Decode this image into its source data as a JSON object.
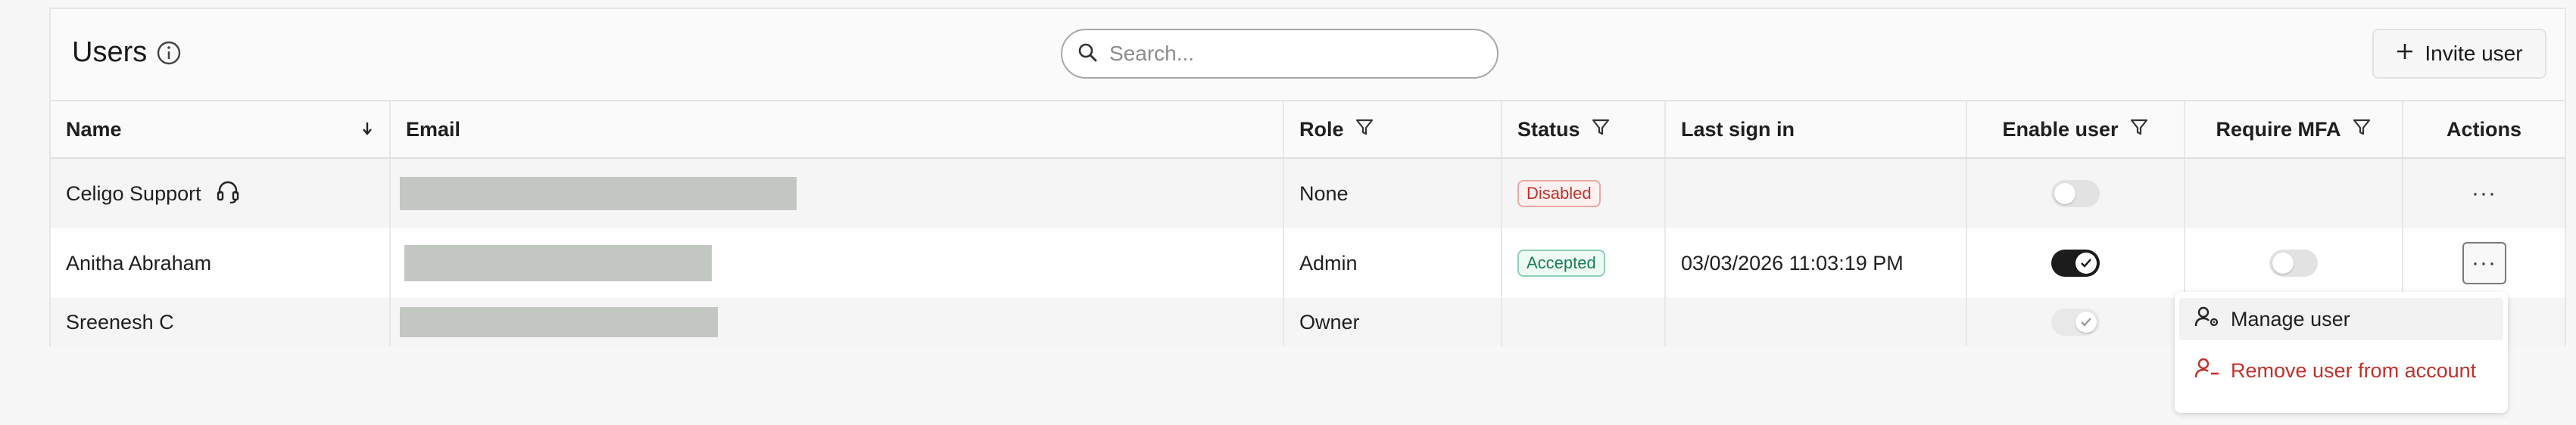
{
  "header": {
    "title": "Users",
    "search_placeholder": "Search...",
    "invite_label": "Invite user"
  },
  "columns": {
    "name": "Name",
    "email": "Email",
    "role": "Role",
    "status": "Status",
    "last_sign_in": "Last sign in",
    "enable_user": "Enable user",
    "require_mfa": "Require MFA",
    "actions": "Actions"
  },
  "rows": [
    {
      "name": "Celigo Support",
      "role": "None",
      "status": "Disabled",
      "last_sign_in": "",
      "enable_user": "off",
      "require_mfa": ""
    },
    {
      "name": "Anitha Abraham",
      "role": "Admin",
      "status": "Accepted",
      "last_sign_in": "03/03/2026 11:03:19 PM",
      "enable_user": "on",
      "require_mfa": "off"
    },
    {
      "name": "Sreenesh C",
      "role": "Owner",
      "status": "",
      "last_sign_in": "",
      "enable_user": "on-disabled",
      "require_mfa": ""
    }
  ],
  "actions_label": "···",
  "menu": {
    "manage": "Manage user",
    "remove": "Remove user from account"
  },
  "colors": {
    "disabled_badge": "#c0312b",
    "accepted_badge": "#178055",
    "redaction": "#c2c8c1",
    "toggle_on": "#1c1c1c"
  },
  "icons": [
    "info-icon",
    "search-icon",
    "plus-icon",
    "sort-down-icon",
    "filter-icon",
    "headset-icon",
    "check-icon",
    "user-gear-icon",
    "user-minus-icon"
  ]
}
